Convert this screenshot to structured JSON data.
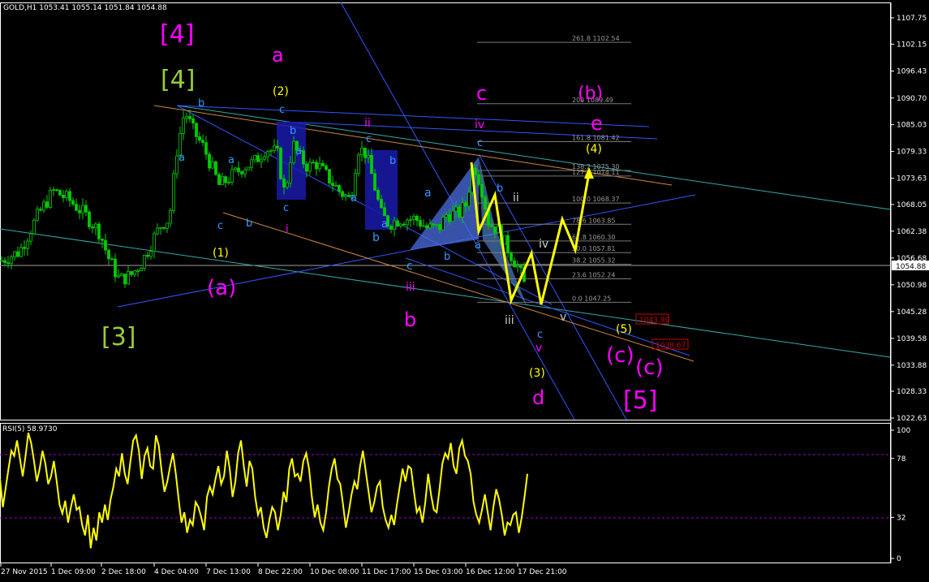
{
  "header": {
    "title": "GOLD,H1",
    "ohlc": "1053.41 1055.14 1051.84 1054.88"
  },
  "rsi_header": {
    "name": "RSI(5)",
    "value": "58.9730"
  },
  "colors": {
    "background": "#000000",
    "candles": "#00cc00",
    "axis": "#ffffff",
    "rsi_line": "#ffff00",
    "rsi_levels": "#9900cc",
    "wave_magenta": "#ff00ff",
    "wave_green": "#99cc33",
    "wave_yellow": "#ffff00",
    "wave_blue": "#3399ff",
    "current_price_box": "#ffffff",
    "alert_box": "#cc0000"
  },
  "chart_data": [
    {
      "type": "candlestick",
      "symbol": "GOLD",
      "timeframe": "H1",
      "title": "GOLD,H1",
      "ylim": [
        1022.63,
        1107.75
      ],
      "price_axis_ticks": [
        "1107.75",
        "1102.15",
        "1096.43",
        "1090.70",
        "1085.03",
        "1079.33",
        "1073.63",
        "1068.05",
        "1062.38",
        "1056.68",
        "1050.98",
        "1045.28",
        "1039.58",
        "1033.88",
        "1028.33",
        "1022.63"
      ],
      "current_price": "1054.88",
      "time_axis_ticks": [
        "27 Nov 2015",
        "1 Dec 09:00",
        "2 Dec 18:00",
        "4 Dec 04:00",
        "7 Dec 13:00",
        "8 Dec 22:00",
        "10 Dec 08:00",
        "11 Dec 17:00",
        "15 Dec 03:00",
        "16 Dec 12:00",
        "17 Dec 21:00"
      ],
      "price_path": [
        [
          0,
          1056
        ],
        [
          5,
          1058
        ],
        [
          10,
          1066
        ],
        [
          14,
          1071
        ],
        [
          18,
          1069
        ],
        [
          22,
          1066
        ],
        [
          26,
          1062
        ],
        [
          28,
          1057
        ],
        [
          31,
          1052
        ],
        [
          34,
          1053
        ],
        [
          37,
          1056
        ],
        [
          40,
          1061
        ],
        [
          42,
          1064
        ],
        [
          44,
          1065
        ],
        [
          46,
          1080
        ],
        [
          48,
          1088
        ],
        [
          50,
          1084
        ],
        [
          53,
          1080
        ],
        [
          57,
          1072
        ],
        [
          60,
          1074
        ],
        [
          63,
          1076
        ],
        [
          66,
          1077
        ],
        [
          69,
          1080
        ],
        [
          72,
          1079
        ],
        [
          74,
          1070
        ],
        [
          76,
          1081
        ],
        [
          78,
          1078
        ],
        [
          80,
          1076
        ],
        [
          82,
          1077
        ],
        [
          85,
          1074
        ],
        [
          88,
          1071
        ],
        [
          91,
          1069
        ],
        [
          93,
          1080
        ],
        [
          95,
          1079
        ],
        [
          97,
          1073
        ],
        [
          99,
          1066
        ],
        [
          101,
          1064
        ],
        [
          104,
          1065
        ],
        [
          108,
          1065
        ],
        [
          111,
          1063
        ],
        [
          114,
          1063
        ],
        [
          116,
          1066
        ],
        [
          119,
          1066
        ],
        [
          121,
          1068
        ],
        [
          123,
          1077
        ],
        [
          125,
          1072
        ],
        [
          127,
          1064
        ],
        [
          129,
          1063
        ],
        [
          131,
          1060
        ],
        [
          133,
          1057
        ],
        [
          135,
          1054
        ],
        [
          137,
          1049
        ]
      ],
      "fibonacci_levels": [
        {
          "label": "261.8",
          "price": "1102.54"
        },
        {
          "label": "200",
          "price": "1089.49"
        },
        {
          "label": "161.8",
          "price": "1081.42"
        },
        {
          "label": "138.2",
          "price": "1075.30"
        },
        {
          "label": "127.2",
          "price": "1074.11"
        },
        {
          "label": "100.0",
          "price": "1068.37"
        },
        {
          "label": "78.6",
          "price": "1063.85"
        },
        {
          "label": "61.8",
          "price": "1060.30"
        },
        {
          "label": "50.0",
          "price": "1057.81"
        },
        {
          "label": "38.2",
          "price": "1055.32"
        },
        {
          "label": "23.6",
          "price": "1052.24"
        },
        {
          "label": "0.0",
          "price": "1047.25"
        }
      ],
      "alert_levels": [
        "1043.99",
        "1038.67"
      ],
      "wave_labels": [
        {
          "text": "[4]",
          "color": "#ff00ff"
        },
        {
          "text": "[4]",
          "color": "#99cc33"
        },
        {
          "text": "[3]",
          "color": "#99cc33"
        },
        {
          "text": "[5]",
          "color": "#ff00ff"
        },
        {
          "text": "a",
          "color": "#ff00ff"
        },
        {
          "text": "b",
          "color": "#ff00ff"
        },
        {
          "text": "c",
          "color": "#ff00ff"
        },
        {
          "text": "d",
          "color": "#ff00ff"
        },
        {
          "text": "e",
          "color": "#ff00ff"
        },
        {
          "text": "(b)",
          "color": "#ff00ff"
        },
        {
          "text": "(a)",
          "color": "#ff00ff"
        },
        {
          "text": "(c)",
          "color": "#ff00ff"
        },
        {
          "text": "(c)",
          "color": "#ff00ff"
        },
        {
          "text": "(1)",
          "color": "#ffff00"
        },
        {
          "text": "(2)",
          "color": "#ffff00"
        },
        {
          "text": "(3)",
          "color": "#ffff00"
        },
        {
          "text": "(4)",
          "color": "#ffff00"
        },
        {
          "text": "(5)",
          "color": "#ffff00"
        },
        {
          "text": "i",
          "color": "#ff00ff"
        },
        {
          "text": "ii",
          "color": "#ff00ff"
        },
        {
          "text": "iii",
          "color": "#ff00ff"
        },
        {
          "text": "iv",
          "color": "#ff00ff"
        },
        {
          "text": "v",
          "color": "#ff00ff"
        },
        {
          "text": "ii",
          "color": "#cccccc"
        },
        {
          "text": "iii",
          "color": "#cccccc"
        },
        {
          "text": "iv",
          "color": "#cccccc"
        },
        {
          "text": "v",
          "color": "#cccccc"
        },
        {
          "text": "a",
          "color": "#3399ff"
        },
        {
          "text": "b",
          "color": "#3399ff"
        },
        {
          "text": "c",
          "color": "#3399ff"
        }
      ]
    },
    {
      "type": "line",
      "title": "RSI(5) 58.9730",
      "ylim": [
        0,
        100
      ],
      "axis_ticks": [
        "100",
        "78",
        "32",
        "0"
      ],
      "levels": [
        78,
        32
      ],
      "series": [
        {
          "name": "RSI(5)",
          "values": [
            62,
            40,
            55,
            70,
            84,
            80,
            92,
            78,
            64,
            80,
            98,
            90,
            76,
            60,
            70,
            84,
            74,
            58,
            64,
            76,
            60,
            42,
            35,
            45,
            28,
            40,
            50,
            38,
            40,
            26,
            18,
            34,
            8,
            24,
            14,
            36,
            28,
            42,
            30,
            46,
            56,
            70,
            64,
            82,
            66,
            58,
            76,
            92,
            96,
            84,
            62,
            80,
            86,
            72,
            70,
            96,
            88,
            68,
            52,
            60,
            72,
            82,
            66,
            46,
            28,
            36,
            20,
            30,
            26,
            44,
            40,
            32,
            22,
            48,
            56,
            50,
            62,
            72,
            58,
            64,
            84,
            70,
            48,
            60,
            82,
            92,
            72,
            56,
            76,
            70,
            48,
            34,
            40,
            24,
            16,
            30,
            40,
            36,
            22,
            34,
            52,
            44,
            70,
            78,
            64,
            66,
            60,
            76,
            82,
            70,
            48,
            32,
            42,
            28,
            22,
            36,
            56,
            70,
            78,
            62,
            58,
            42,
            24,
            36,
            50,
            60,
            54,
            72,
            84,
            68,
            52,
            36,
            44,
            56,
            60,
            40,
            30,
            24,
            34,
            26,
            42,
            56,
            70,
            60,
            72,
            70,
            52,
            36,
            40,
            28,
            44,
            66,
            50,
            38,
            36,
            54,
            74,
            82,
            78,
            90,
            72,
            66,
            86,
            92,
            80,
            76,
            66,
            44,
            34,
            28,
            38,
            50,
            36,
            22,
            40,
            54,
            46,
            34,
            18,
            28,
            26,
            34,
            36,
            20,
            32,
            48,
            66
          ]
        }
      ]
    }
  ]
}
